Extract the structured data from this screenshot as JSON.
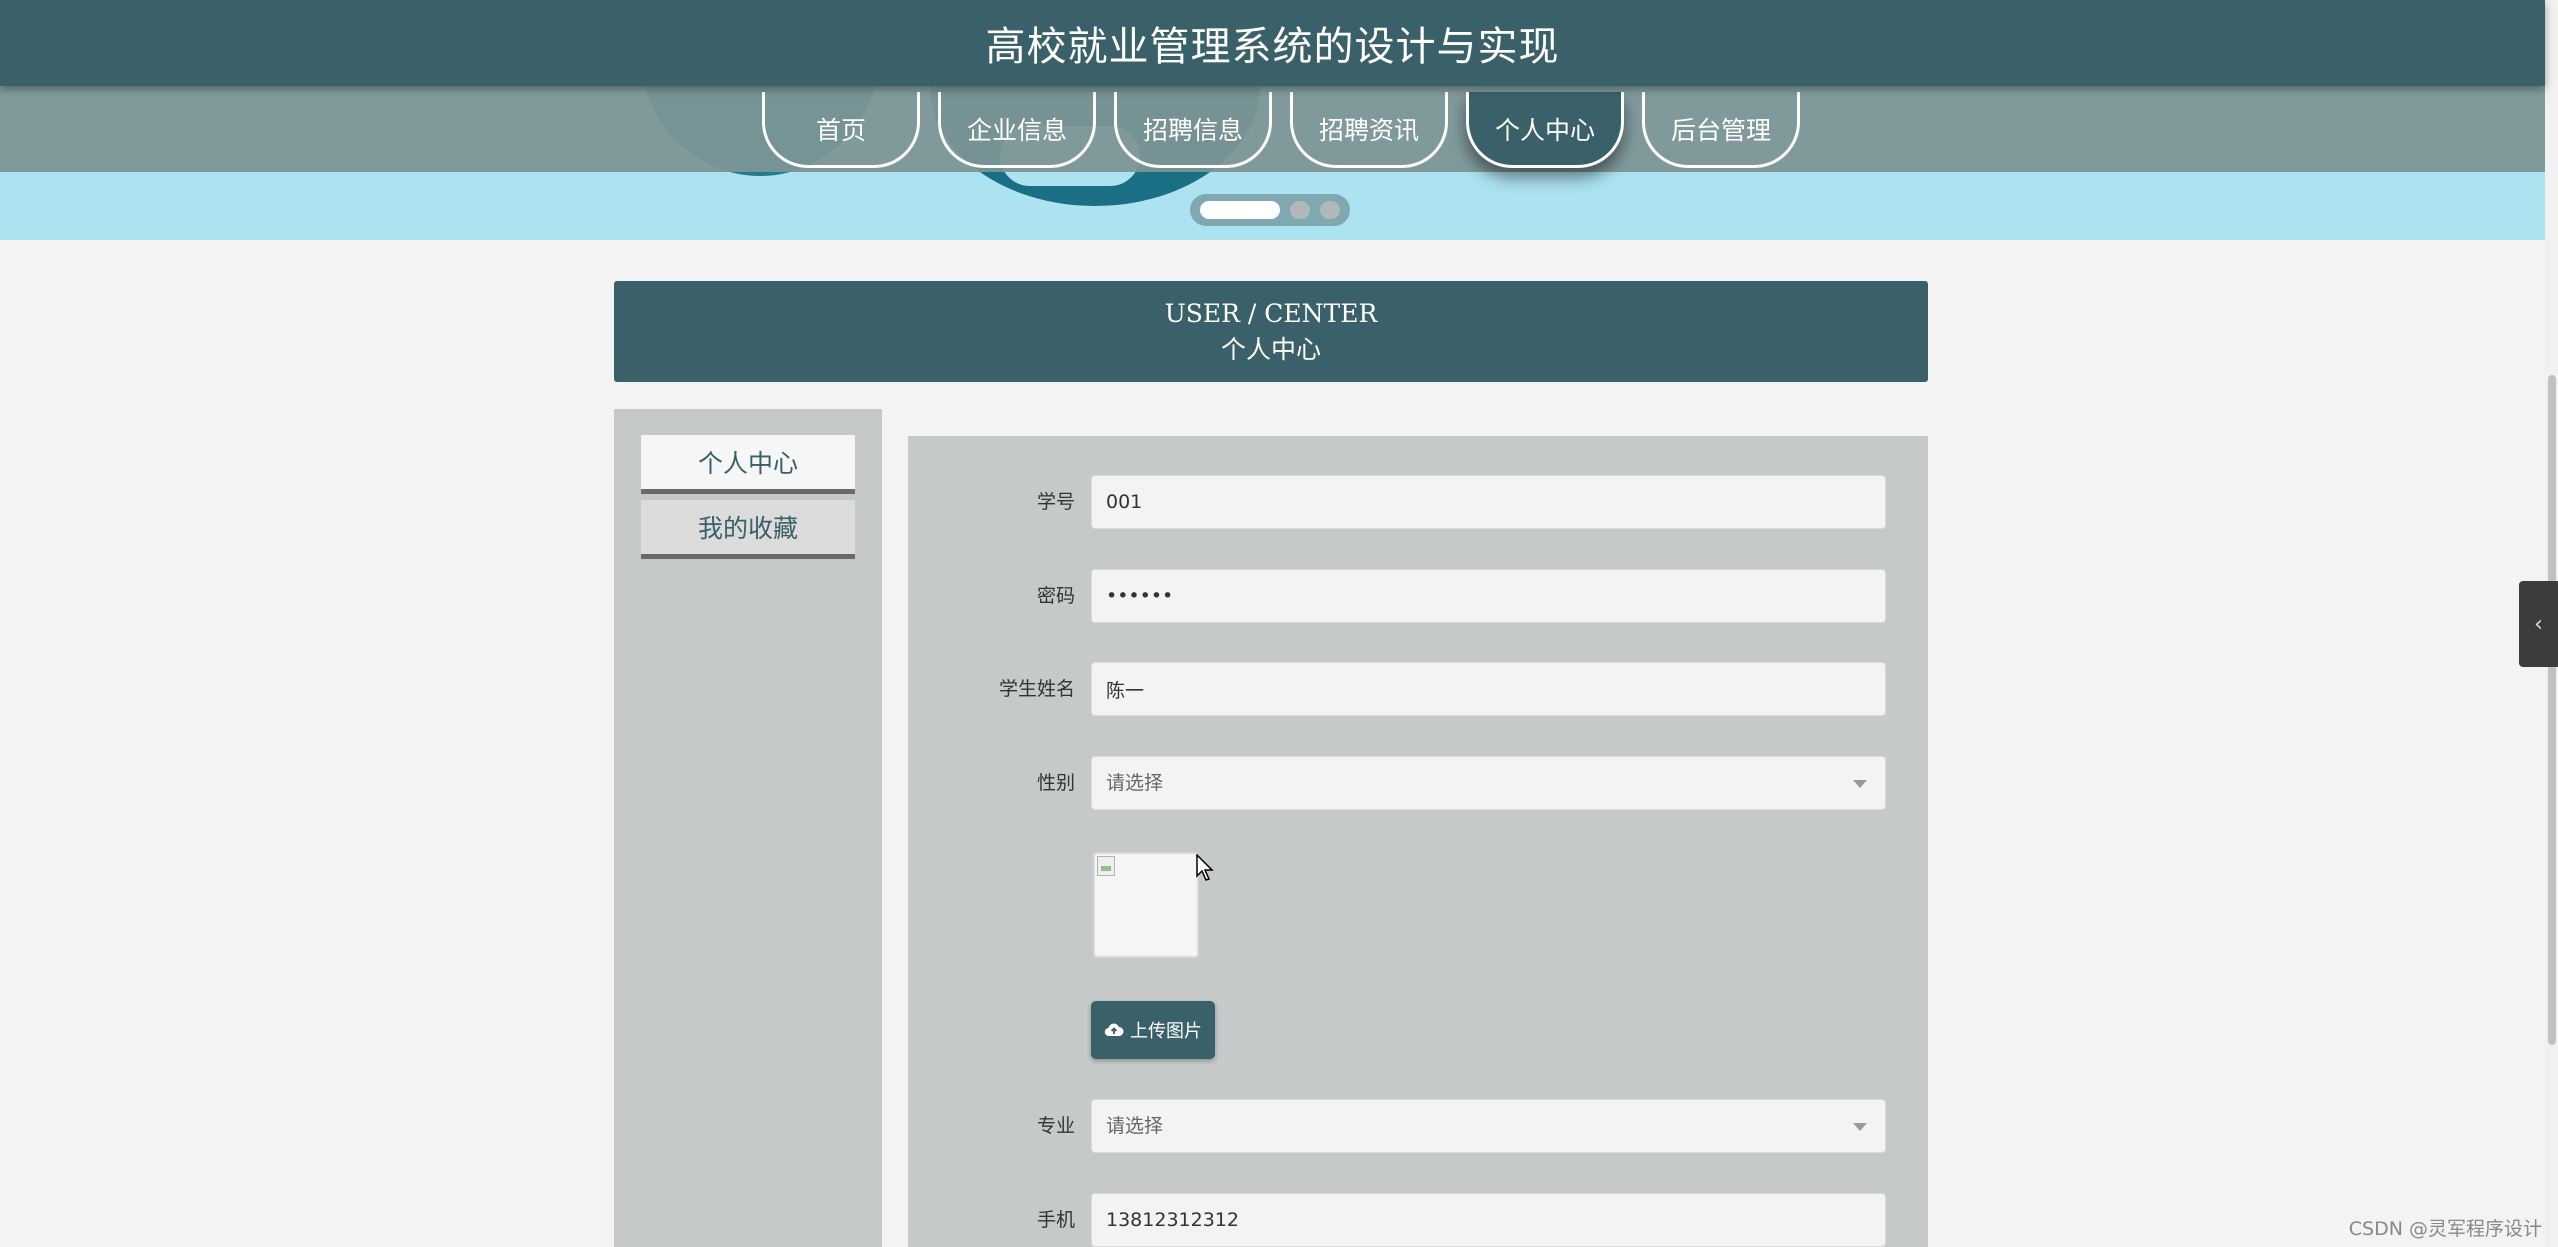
{
  "header": {
    "title": "高校就业管理系统的设计与实现"
  },
  "nav": {
    "items": [
      {
        "label": "首页",
        "active": false
      },
      {
        "label": "企业信息",
        "active": false
      },
      {
        "label": "招聘信息",
        "active": false
      },
      {
        "label": "招聘资讯",
        "active": false
      },
      {
        "label": "个人中心",
        "active": true
      },
      {
        "label": "后台管理",
        "active": false
      }
    ]
  },
  "page_heading": {
    "en": "USER / CENTER",
    "zh": "个人中心"
  },
  "sidebar": {
    "items": [
      {
        "label": "个人中心",
        "active": true
      },
      {
        "label": "我的收藏",
        "active": false
      }
    ]
  },
  "form": {
    "student_id": {
      "label": "学号",
      "value": "001"
    },
    "password": {
      "label": "密码",
      "value": "••••••"
    },
    "student_name": {
      "label": "学生姓名",
      "value": "陈一"
    },
    "gender": {
      "label": "性别",
      "selected": "请选择"
    },
    "upload_button": "上传图片",
    "major": {
      "label": "专业",
      "selected": "请选择"
    },
    "phone": {
      "label": "手机",
      "value": "13812312312"
    }
  },
  "side_toggle": {
    "icon": "chevron-left-icon",
    "glyph": "‹"
  },
  "watermark": "CSDN @灵军程序设计",
  "colors": {
    "primary": "#3a6069",
    "nav_bg": "#7d9496",
    "banner_bg": "#ade3f0",
    "panel_bg": "#c5c9ca",
    "page_bg": "#f3f3f3"
  }
}
